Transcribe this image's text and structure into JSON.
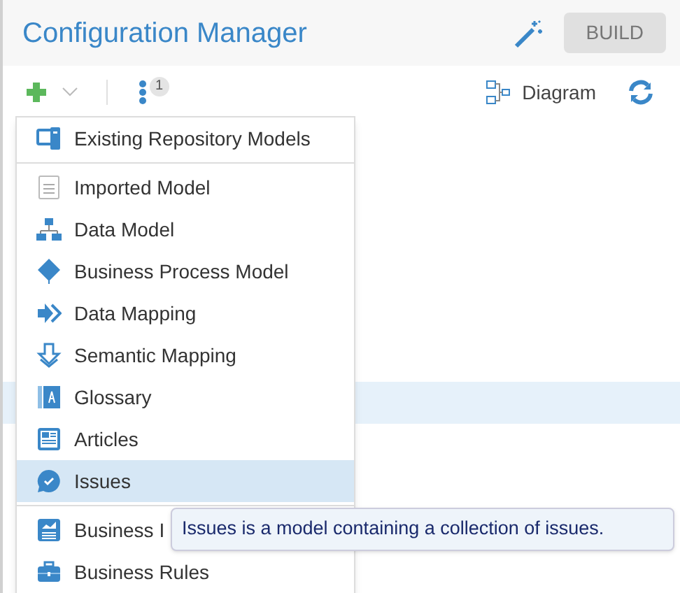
{
  "header": {
    "title": "Configuration Manager",
    "build_button": "BUILD"
  },
  "toolbar": {
    "badge": "1",
    "diagram_button": "Diagram"
  },
  "menu": {
    "sections": [
      [
        {
          "label": "Existing Repository Models",
          "selected": false
        }
      ],
      [
        {
          "label": "Imported Model",
          "selected": false
        },
        {
          "label": "Data Model",
          "selected": false
        },
        {
          "label": "Business Process Model",
          "selected": false
        },
        {
          "label": "Data Mapping",
          "selected": false
        },
        {
          "label": "Semantic Mapping",
          "selected": false
        },
        {
          "label": "Glossary",
          "selected": false
        },
        {
          "label": "Articles",
          "selected": false
        },
        {
          "label": "Issues",
          "selected": true
        }
      ],
      [
        {
          "label": "Business I",
          "selected": false
        },
        {
          "label": "Business Rules",
          "selected": false
        }
      ]
    ]
  },
  "tooltip": "Issues is a model containing a collection of issues."
}
